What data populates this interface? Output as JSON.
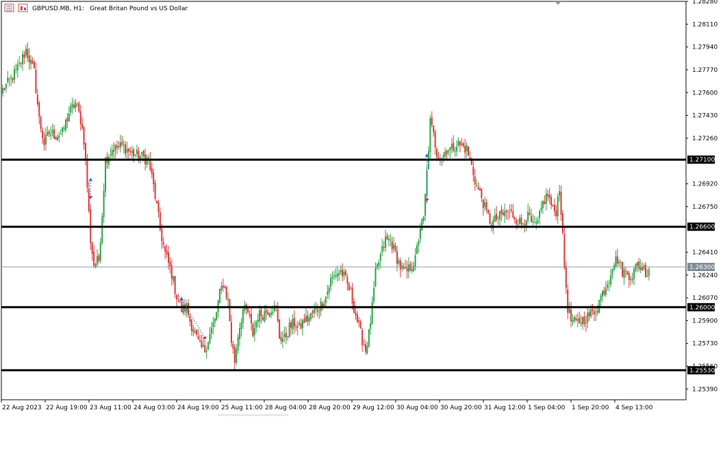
{
  "header": {
    "symbol": "GBPUSD.MB, H1:",
    "description": "Great Britan Pound vs US Dollar"
  },
  "colors": {
    "bull": "#26a240",
    "bear": "#dd3333",
    "level_line": "#000000",
    "current_line": "#8899aa",
    "current_label_bg": "#7f8a95",
    "arrow_buy": "#1f6fd1",
    "arrow_sell": "#dd3333"
  },
  "chart_data": {
    "type": "candlestick",
    "title": "",
    "ylim": [
      1.2531,
      1.2828
    ],
    "y_ticks": [
      "1.28280",
      "1.28110",
      "1.27940",
      "1.27770",
      "1.27600",
      "1.27430",
      "1.27260",
      "1.26920",
      "1.26750",
      "1.26410",
      "1.26240",
      "1.26070",
      "1.25900",
      "1.25730",
      "1.25560",
      "1.25390"
    ],
    "x_ticks": [
      "22 Aug 2023",
      "22 Aug 19:00",
      "23 Aug 11:00",
      "24 Aug 03:00",
      "24 Aug 19:00",
      "25 Aug 11:00",
      "28 Aug 04:00",
      "28 Aug 20:00",
      "29 Aug 12:00",
      "30 Aug 04:00",
      "30 Aug 20:00",
      "31 Aug 12:00",
      "1 Sep 04:00",
      "1 Sep 20:00",
      "4 Sep 13:00"
    ],
    "horizontal_levels": [
      {
        "value": 1.271,
        "label": "1.27100"
      },
      {
        "value": 1.266,
        "label": "1.26600"
      },
      {
        "value": 1.26,
        "label": "1.26000"
      },
      {
        "value": 1.2553,
        "label": "1.25530"
      }
    ],
    "current_price": {
      "value": 1.263,
      "label": "1.26300"
    },
    "anchors": [
      [
        0,
        1.2762
      ],
      [
        5,
        1.277
      ],
      [
        10,
        1.278
      ],
      [
        14,
        1.2792
      ],
      [
        19,
        1.2775
      ],
      [
        22,
        1.274
      ],
      [
        25,
        1.2722
      ],
      [
        28,
        1.273
      ],
      [
        32,
        1.2728
      ],
      [
        36,
        1.273
      ],
      [
        40,
        1.2745
      ],
      [
        44,
        1.2752
      ],
      [
        47,
        1.274
      ],
      [
        49,
        1.2725
      ],
      [
        51,
        1.269
      ],
      [
        53,
        1.265
      ],
      [
        55,
        1.2632
      ],
      [
        58,
        1.2635
      ],
      [
        60,
        1.267
      ],
      [
        62,
        1.271
      ],
      [
        66,
        1.2718
      ],
      [
        72,
        1.272
      ],
      [
        78,
        1.2715
      ],
      [
        84,
        1.2712
      ],
      [
        88,
        1.271
      ],
      [
        91,
        1.269
      ],
      [
        93,
        1.2675
      ],
      [
        95,
        1.2658
      ],
      [
        98,
        1.264
      ],
      [
        102,
        1.2625
      ],
      [
        105,
        1.2608
      ],
      [
        108,
        1.2598
      ],
      [
        111,
        1.26
      ],
      [
        113,
        1.259
      ],
      [
        116,
        1.258
      ],
      [
        119,
        1.257
      ],
      [
        122,
        1.2568
      ],
      [
        125,
        1.258
      ],
      [
        128,
        1.259
      ],
      [
        131,
        1.261
      ],
      [
        133,
        1.2618
      ],
      [
        136,
        1.2605
      ],
      [
        138,
        1.2575
      ],
      [
        140,
        1.256
      ],
      [
        142,
        1.258
      ],
      [
        145,
        1.2598
      ],
      [
        148,
        1.2596
      ],
      [
        151,
        1.258
      ],
      [
        154,
        1.2594
      ],
      [
        157,
        1.2595
      ],
      [
        160,
        1.2598
      ],
      [
        163,
        1.26
      ],
      [
        165,
        1.2598
      ],
      [
        167,
        1.2578
      ],
      [
        170,
        1.2576
      ],
      [
        173,
        1.2585
      ],
      [
        176,
        1.2588
      ],
      [
        179,
        1.2584
      ],
      [
        182,
        1.259
      ],
      [
        185,
        1.2592
      ],
      [
        188,
        1.2597
      ],
      [
        191,
        1.26
      ],
      [
        195,
        1.2608
      ],
      [
        198,
        1.262
      ],
      [
        201,
        1.2625
      ],
      [
        204,
        1.2627
      ],
      [
        207,
        1.262
      ],
      [
        210,
        1.261
      ],
      [
        213,
        1.2595
      ],
      [
        216,
        1.258
      ],
      [
        219,
        1.2568
      ],
      [
        221,
        1.258
      ],
      [
        223,
        1.26
      ],
      [
        225,
        1.2625
      ],
      [
        228,
        1.2638
      ],
      [
        231,
        1.265
      ],
      [
        234,
        1.265
      ],
      [
        237,
        1.264
      ],
      [
        240,
        1.263
      ],
      [
        243,
        1.2625
      ],
      [
        246,
        1.263
      ],
      [
        249,
        1.2635
      ],
      [
        252,
        1.266
      ],
      [
        254,
        1.2665
      ],
      [
        256,
        1.27
      ],
      [
        258,
        1.2738
      ],
      [
        260,
        1.2728
      ],
      [
        262,
        1.2715
      ],
      [
        265,
        1.2712
      ],
      [
        268,
        1.2718
      ],
      [
        271,
        1.2718
      ],
      [
        274,
        1.2722
      ],
      [
        277,
        1.272
      ],
      [
        280,
        1.2718
      ],
      [
        283,
        1.2705
      ],
      [
        286,
        1.269
      ],
      [
        289,
        1.2682
      ],
      [
        292,
        1.267
      ],
      [
        295,
        1.2662
      ],
      [
        298,
        1.2666
      ],
      [
        301,
        1.2668
      ],
      [
        304,
        1.2671
      ],
      [
        307,
        1.267
      ],
      [
        310,
        1.2666
      ],
      [
        313,
        1.2662
      ],
      [
        316,
        1.2668
      ],
      [
        318,
        1.2666
      ],
      [
        320,
        1.266
      ],
      [
        323,
        1.2662
      ],
      [
        326,
        1.2678
      ],
      [
        329,
        1.2684
      ],
      [
        332,
        1.2672
      ],
      [
        334,
        1.2672
      ],
      [
        336,
        1.269
      ],
      [
        337,
        1.2672
      ],
      [
        339,
        1.263
      ],
      [
        341,
        1.26
      ],
      [
        343,
        1.259
      ],
      [
        346,
        1.2588
      ],
      [
        349,
        1.259
      ],
      [
        352,
        1.2592
      ],
      [
        355,
        1.2595
      ],
      [
        358,
        1.2598
      ],
      [
        361,
        1.2608
      ],
      [
        364,
        1.2616
      ],
      [
        366,
        1.2622
      ],
      [
        368,
        1.2632
      ],
      [
        371,
        1.2636
      ],
      [
        374,
        1.2627
      ],
      [
        377,
        1.2625
      ],
      [
        380,
        1.2624
      ],
      [
        383,
        1.2632
      ],
      [
        386,
        1.263
      ],
      [
        389,
        1.2625
      ],
      [
        390,
        1.263
      ]
    ],
    "trade_markers": [
      {
        "candle": 53,
        "value": 1.2695,
        "type": "buy"
      },
      {
        "candle": 53,
        "value": 1.2682,
        "type": "sell"
      },
      {
        "candle": 108,
        "value": 1.2606,
        "type": "buy"
      },
      {
        "candle": 122,
        "value": 1.2577,
        "type": "sell"
      },
      {
        "candle": 256,
        "value": 1.2713,
        "type": "buy"
      },
      {
        "candle": 256,
        "value": 1.268,
        "type": "sell"
      }
    ]
  }
}
